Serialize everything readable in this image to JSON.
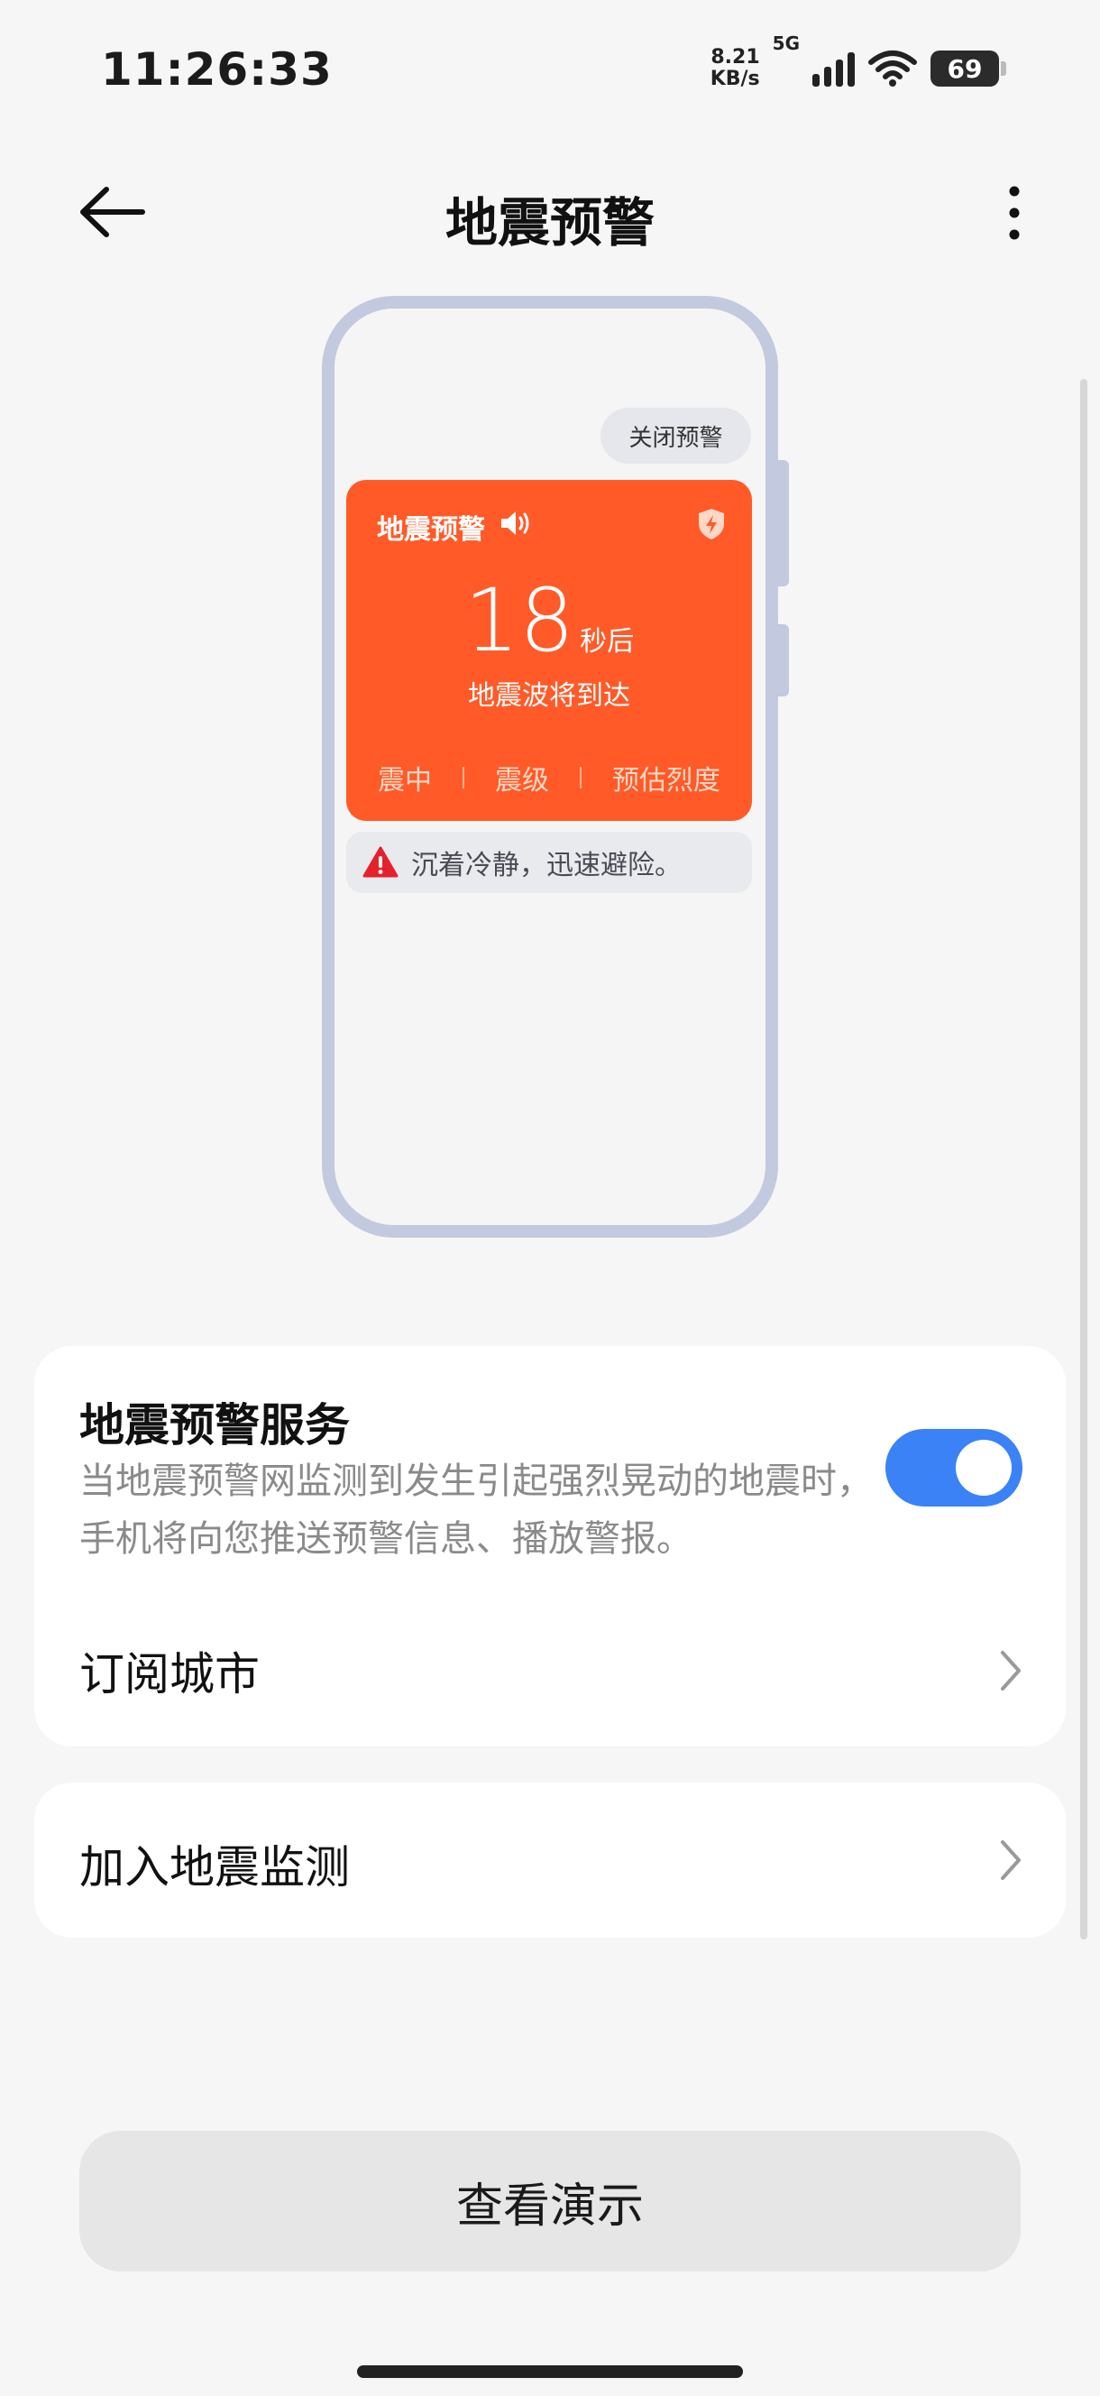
{
  "status_bar": {
    "time": "11:26:33",
    "net_speed_value": "8.21",
    "net_speed_unit": "KB/s",
    "network_type": "5G",
    "battery": "69"
  },
  "header": {
    "title": "地震预警",
    "back_icon": "back-arrow-icon",
    "more_icon": "more-vertical-icon"
  },
  "illustration": {
    "close_alert_label": "关闭预警",
    "alert_title": "地震预警",
    "countdown_value": "18",
    "countdown_unit": "秒后",
    "countdown_subtitle": "地震波将到达",
    "stats": [
      "震中",
      "震级",
      "预估烈度"
    ],
    "warning_text": "沉着冷静，迅速避险。",
    "colors": {
      "alert_bg": "#ff5a28",
      "phone_frame": "#c3c9de"
    }
  },
  "service": {
    "title": "地震预警服务",
    "description": "当地震预警网监测到发生引起强烈晃动的地震时，手机将向您推送预警信息、播放警报。",
    "toggle_on": true,
    "toggle_color": "#3b82f6"
  },
  "rows": {
    "subscribe_city": "订阅城市",
    "join_monitoring": "加入地震监测"
  },
  "demo_button_label": "查看演示"
}
